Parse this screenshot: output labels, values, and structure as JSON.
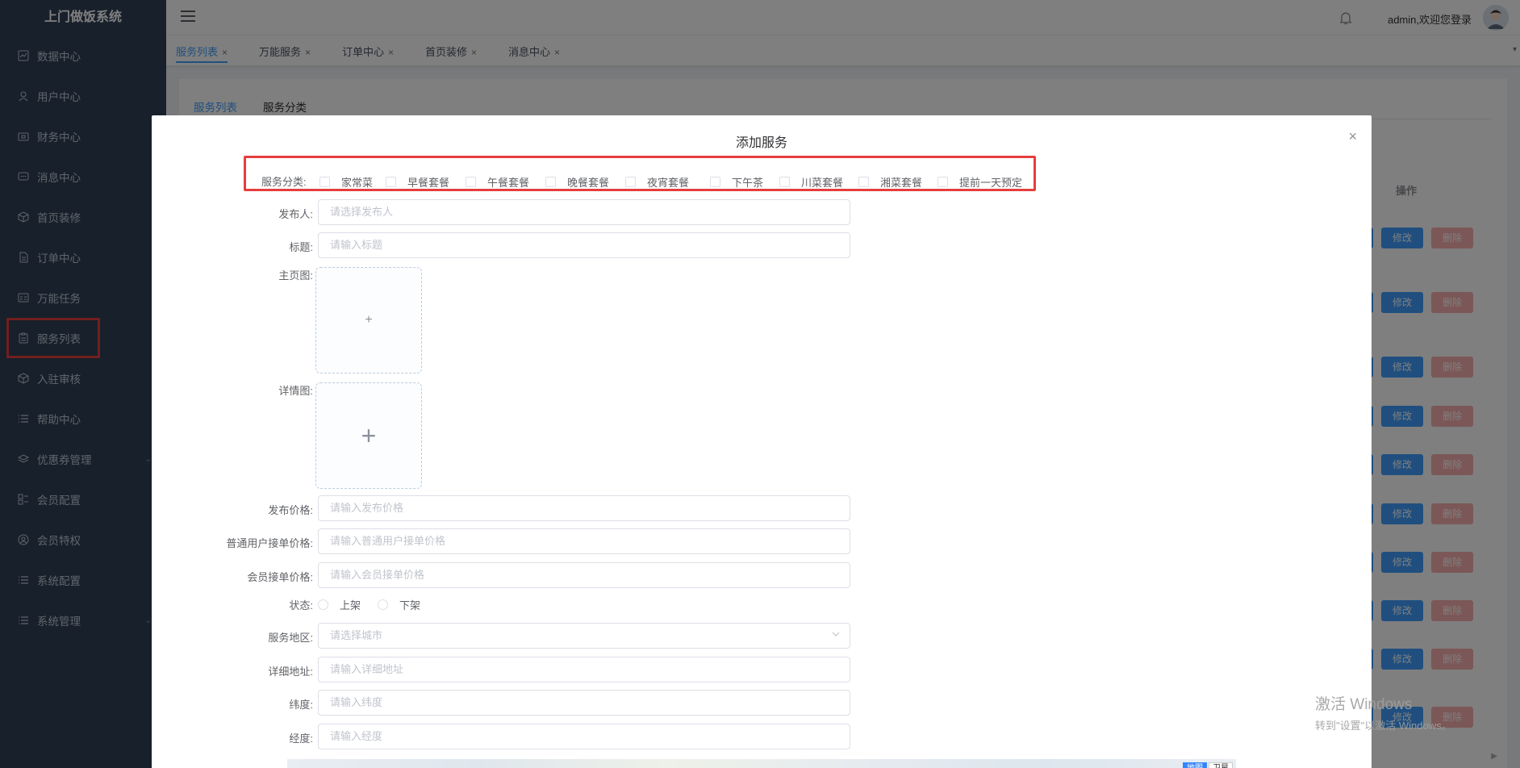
{
  "app": {
    "title": "上门做饭系统"
  },
  "sidebar": {
    "items": [
      {
        "label": "数据中心",
        "icon": "chart-icon"
      },
      {
        "label": "用户中心",
        "icon": "user-icon"
      },
      {
        "label": "财务中心",
        "icon": "wallet-icon"
      },
      {
        "label": "消息中心",
        "icon": "message-icon"
      },
      {
        "label": "首页装修",
        "icon": "cube-icon"
      },
      {
        "label": "订单中心",
        "icon": "document-icon"
      },
      {
        "label": "万能任务",
        "icon": "task-icon"
      },
      {
        "label": "服务列表",
        "icon": "clipboard-icon"
      },
      {
        "label": "入驻审核",
        "icon": "cube-icon"
      },
      {
        "label": "帮助中心",
        "icon": "list-icon"
      },
      {
        "label": "优惠券管理",
        "icon": "layers-icon"
      },
      {
        "label": "会员配置",
        "icon": "grid-icon"
      },
      {
        "label": "会员特权",
        "icon": "badge-icon"
      },
      {
        "label": "系统配置",
        "icon": "list-icon"
      },
      {
        "label": "系统管理",
        "icon": "list-icon"
      }
    ]
  },
  "header": {
    "user_text": "admin,欢迎您登录"
  },
  "tags": [
    {
      "label": "服务列表",
      "close": "×"
    },
    {
      "label": "万能服务",
      "close": "×"
    },
    {
      "label": "订单中心",
      "close": "×"
    },
    {
      "label": "首页装修",
      "close": "×"
    },
    {
      "label": "消息中心",
      "close": "×"
    }
  ],
  "page": {
    "tabs": [
      {
        "label": "服务列表"
      },
      {
        "label": "服务分类"
      }
    ],
    "op_header": "操作",
    "edit_label": "修改",
    "delete_label": "删除"
  },
  "dialog": {
    "title": "添加服务",
    "close": "×",
    "category_label": "服务分类:",
    "categories": [
      "家常菜",
      "早餐套餐",
      "午餐套餐",
      "晚餐套餐",
      "夜宵套餐",
      "下午茶",
      "川菜套餐",
      "湘菜套餐",
      "提前一天预定"
    ],
    "publisher": {
      "label": "发布人:",
      "placeholder": "请选择发布人"
    },
    "title_field": {
      "label": "标题:",
      "placeholder": "请输入标题"
    },
    "main_image": {
      "label": "主页图:",
      "plus": "+"
    },
    "detail_image": {
      "label": "详情图:",
      "plus": "+"
    },
    "price": {
      "label": "发布价格:",
      "placeholder": "请输入发布价格"
    },
    "normal_price": {
      "label": "普通用户接单价格:",
      "placeholder": "请输入普通用户接单价格"
    },
    "member_price": {
      "label": "会员接单价格:",
      "placeholder": "请输入会员接单价格"
    },
    "status": {
      "label": "状态:",
      "options": [
        "上架",
        "下架"
      ]
    },
    "region": {
      "label": "服务地区:",
      "placeholder": "请选择城市"
    },
    "address": {
      "label": "详细地址:",
      "placeholder": "请输入详细地址"
    },
    "latitude": {
      "label": "纬度:",
      "placeholder": "请输入纬度"
    },
    "longitude": {
      "label": "经度:",
      "placeholder": "请输入经度"
    },
    "map_buttons": [
      "地图",
      "卫星"
    ]
  },
  "watermark": {
    "line1": "激活 Windows",
    "line2": "转到\"设置\"以激活 Windows。"
  }
}
